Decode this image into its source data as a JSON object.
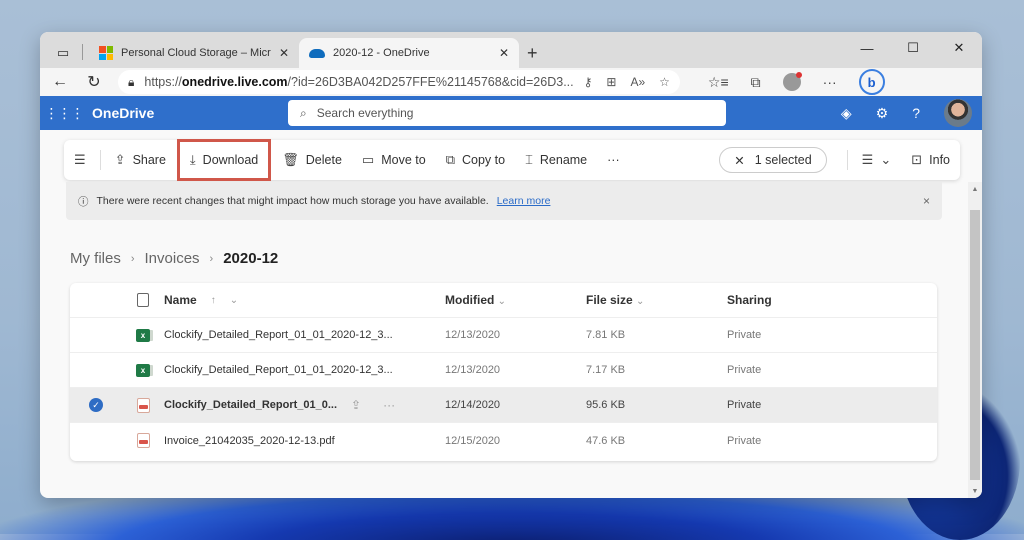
{
  "browser": {
    "tabs": [
      {
        "title": "Personal Cloud Storage – Microso",
        "icon": "microsoft-logo",
        "active": false
      },
      {
        "title": "2020-12 - OneDrive",
        "icon": "onedrive-cloud",
        "active": true
      }
    ],
    "new_tab": "+",
    "window_controls": {
      "minimize": "—",
      "maximize": "☐",
      "close": "✕"
    },
    "url_prefix": "https://",
    "url_domain": "onedrive.live.com",
    "url_rest": "/?id=26D3BA042D257FFE%21145768&cid=26D3...",
    "nav": {
      "back": "←",
      "refresh": "↻"
    }
  },
  "app": {
    "name": "OneDrive",
    "search_placeholder": "Search everything"
  },
  "toolbar": {
    "menu": "☰",
    "share": "Share",
    "download": "Download",
    "delete": "Delete",
    "move_to": "Move to",
    "copy_to": "Copy to",
    "rename": "Rename",
    "more": "···",
    "selected": "1 selected",
    "info": "Info"
  },
  "notice": {
    "text": "There were recent changes that might impact how much storage you have available.",
    "link": "Learn more",
    "close": "×"
  },
  "breadcrumb": [
    "My files",
    "Invoices",
    "2020-12"
  ],
  "table": {
    "headers": {
      "name": "Name",
      "modified": "Modified",
      "size": "File size",
      "sharing": "Sharing"
    },
    "sort_indicator": "↑",
    "rows": [
      {
        "type": "xlsx",
        "name": "Clockify_Detailed_Report_01_01_2020-12_3...",
        "modified": "12/13/2020",
        "size": "7.81 KB",
        "sharing": "Private",
        "selected": false
      },
      {
        "type": "xlsx",
        "name": "Clockify_Detailed_Report_01_01_2020-12_3...",
        "modified": "12/13/2020",
        "size": "7.17 KB",
        "sharing": "Private",
        "selected": false
      },
      {
        "type": "pdf",
        "name": "Clockify_Detailed_Report_01_0...",
        "modified": "12/14/2020",
        "size": "95.6 KB",
        "sharing": "Private",
        "selected": true
      },
      {
        "type": "pdf",
        "name": "Invoice_21042035_2020-12-13.pdf",
        "modified": "12/15/2020",
        "size": "47.6 KB",
        "sharing": "Private",
        "selected": false
      }
    ]
  },
  "colors": {
    "brand_blue": "#2f6fcb",
    "highlight_border": "#d0574a",
    "check_blue": "#2e6cc4"
  }
}
